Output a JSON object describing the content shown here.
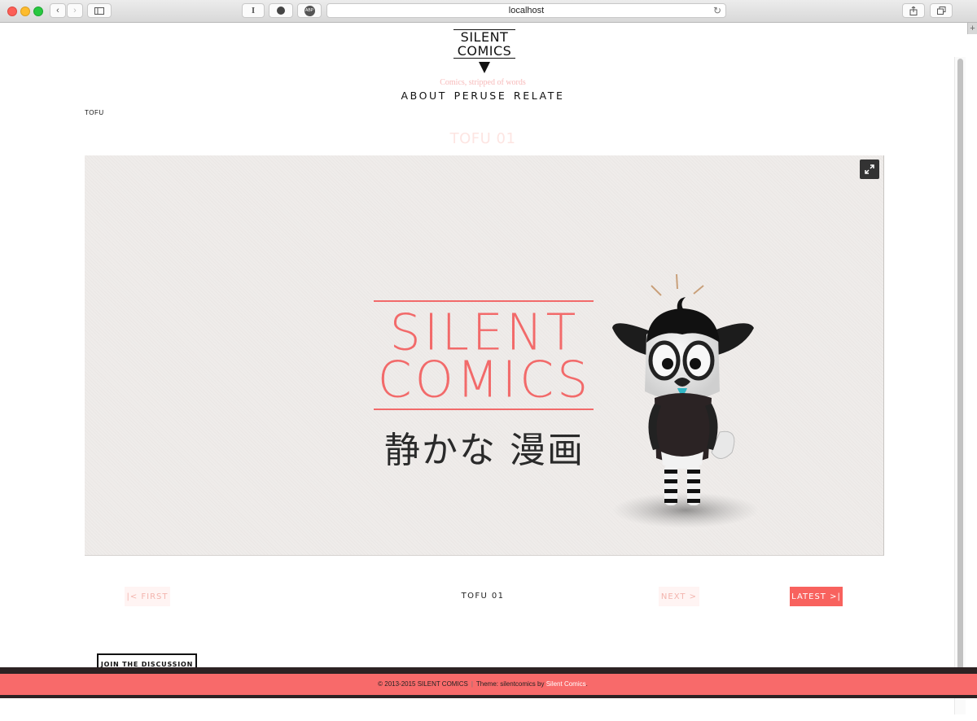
{
  "browser": {
    "url": "localhost",
    "reader_label": "I",
    "extension_label": "ABP"
  },
  "site": {
    "logo_line1": "SILENT",
    "logo_line2": "COMICS",
    "tagline": "Comics, stripped of words",
    "nav": [
      "ABOUT",
      "PERUSE",
      "RELATE"
    ]
  },
  "breadcrumb": "TOFU",
  "comic": {
    "title": "TOFU 01",
    "art_line1": "SILENT",
    "art_line2": "COMICS",
    "art_japanese": "静かな 漫画"
  },
  "pager": {
    "first": "|< FIRST",
    "current": "TOFU 01",
    "next": "NEXT >",
    "latest": "LATEST >|"
  },
  "discussion_button": "JOIN THE DISCUSSION",
  "footer": {
    "copyright": "© 2013-2015 SILENT COMICS",
    "separator": "|",
    "theme_prefix": "Theme: silentcomics by",
    "theme_link": "Silent Comics",
    "suffix": "."
  },
  "colors": {
    "accent": "#f8625e",
    "title_pink": "#fde5e2",
    "footer_dark": "#2c2223"
  }
}
